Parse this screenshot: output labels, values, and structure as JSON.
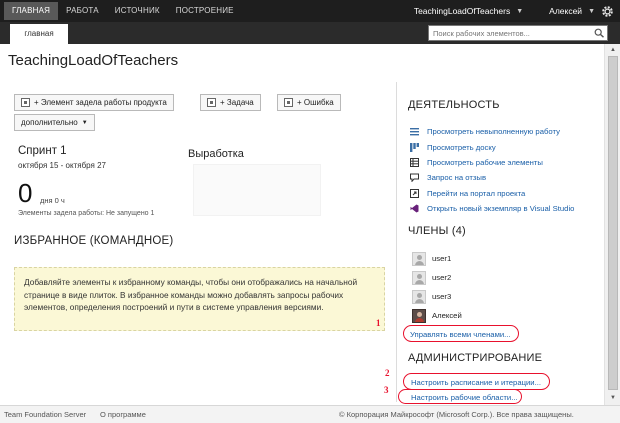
{
  "nav": {
    "tabs": [
      "ГЛАВНАЯ",
      "РАБОТА",
      "ИСТОЧНИК",
      "ПОСТРОЕНИЕ"
    ],
    "active_tab": "ГЛАВНАЯ",
    "project_selector": "TeachingLoadOfTeachers",
    "user": "Алексей",
    "settings_icon": "gear-icon"
  },
  "subnav": {
    "tab": "главная",
    "search_placeholder": "Поиск рабочих элементов...",
    "search_icon": "search-icon"
  },
  "page": {
    "title": "TeachingLoadOfTeachers"
  },
  "actions": {
    "backlog_item": "+ Элемент задела работы продукта",
    "task": "+ Задача",
    "bug": "+ Ошибка",
    "more": "дополнительно"
  },
  "sprint": {
    "name": "Спринт 1",
    "dates": "октября 15 - октября 27",
    "days_count": "0",
    "days_unit": "дня 0 ч",
    "status": "Элементы задела работы: Не запущено 1",
    "burndown_title": "Выработка"
  },
  "favorites": {
    "title": "ИЗБРАННОЕ (КОМАНДНОЕ)",
    "message": "Добавляйте элементы к избранному команды, чтобы они отображались на начальной странице в виде плиток. В избранное команды можно добавлять запросы рабочих элементов, определения построений и пути в системе управления версиями."
  },
  "activity": {
    "title": "ДЕЯТЕЛЬНОСТЬ",
    "items": [
      {
        "label": "Просмотреть невыполненную работу",
        "icon": "list-icon"
      },
      {
        "label": "Просмотреть доску",
        "icon": "board-icon"
      },
      {
        "label": "Просмотреть рабочие элементы",
        "icon": "grid-icon"
      },
      {
        "label": "Запрос на отзыв",
        "icon": "feedback-icon"
      },
      {
        "label": "Перейти на портал проекта",
        "icon": "portal-icon"
      },
      {
        "label": "Открыть новый экземпляр в Visual Studio",
        "icon": "visual-studio-icon"
      }
    ]
  },
  "members": {
    "title": "ЧЛЕНЫ (4)",
    "list": [
      "user1",
      "user2",
      "user3",
      "Алексей"
    ],
    "manage_link": "Управлять всеми членами..."
  },
  "admin": {
    "title": "АДМИНИСТРИРОВАНИЕ",
    "schedule_link": "Настроить расписание и итерации...",
    "areas_link": "Настроить рабочие области..."
  },
  "callouts": [
    "1",
    "2",
    "3"
  ],
  "colors": {
    "top_bar": "#1e1e1e",
    "link": "#1a5fa8",
    "callout": "#e8112d",
    "favorites_bg": "#fbf8d6"
  },
  "footer": {
    "product": "Team Foundation Server",
    "about": "О программе",
    "copyright": "© Корпорация Майкрософт (Microsoft Corp.). Все права защищены."
  }
}
